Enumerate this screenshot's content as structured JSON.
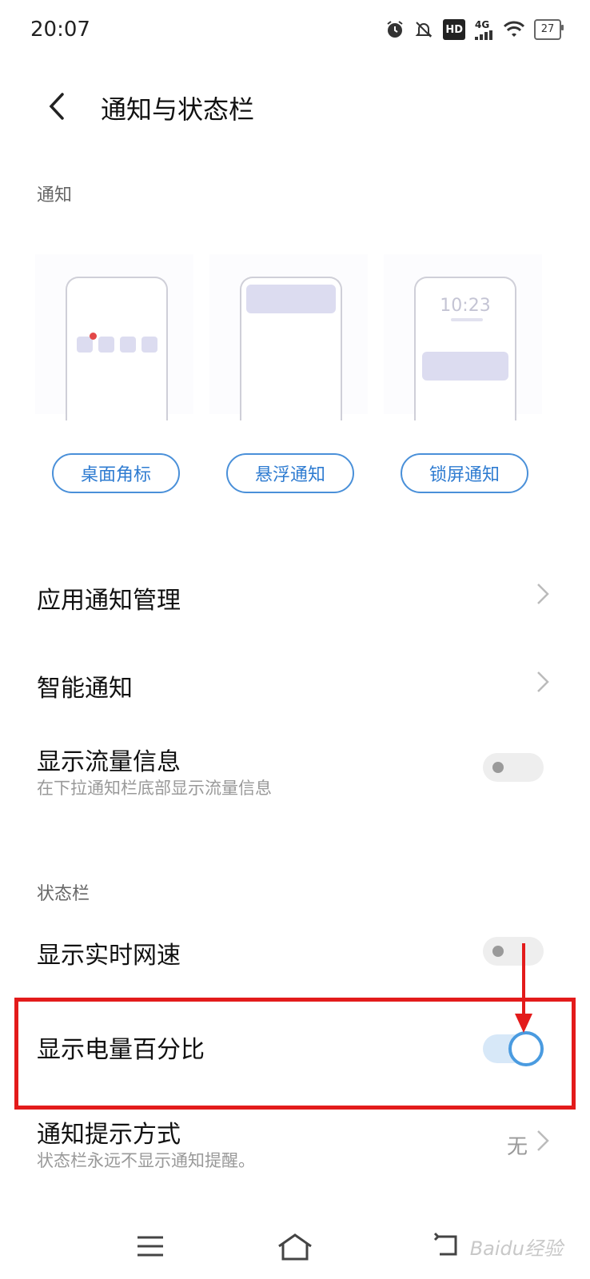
{
  "status_bar": {
    "time": "20:07",
    "icons": [
      "alarm-icon",
      "bell-muted-icon",
      "hd-icon",
      "signal-4g-icon",
      "wifi-icon",
      "battery-icon"
    ],
    "hd_label": "HD",
    "network_label": "4G",
    "battery_level": "27"
  },
  "header": {
    "back_icon": "chevron-left-icon",
    "title": "通知与状态栏"
  },
  "notification_section": {
    "label": "通知",
    "cards": [
      {
        "button": "桌面角标"
      },
      {
        "button": "悬浮通知"
      },
      {
        "button": "锁屏通知",
        "lock_time": "10:23"
      }
    ]
  },
  "rows": {
    "app_notification": {
      "title": "应用通知管理"
    },
    "smart_notification": {
      "title": "智能通知"
    },
    "data_usage": {
      "title": "显示流量信息",
      "subtitle": "在下拉通知栏底部显示流量信息",
      "enabled": false
    }
  },
  "status_bar_section": {
    "label": "状态栏",
    "network_speed": {
      "title": "显示实时网速",
      "enabled": false
    },
    "battery_percent": {
      "title": "显示电量百分比",
      "enabled": true
    },
    "notification_style": {
      "title": "通知提示方式",
      "subtitle": "状态栏永远不显示通知提醒。",
      "value": "无"
    }
  },
  "annotation": {
    "highlight_color": "#e31b1b"
  },
  "nav_bar": {
    "buttons": [
      "menu-icon",
      "home-icon",
      "back-icon"
    ],
    "watermark": "Baidu经验"
  },
  "colors": {
    "accent": "#4a90d9",
    "toggle_on": "#4a9be0"
  }
}
